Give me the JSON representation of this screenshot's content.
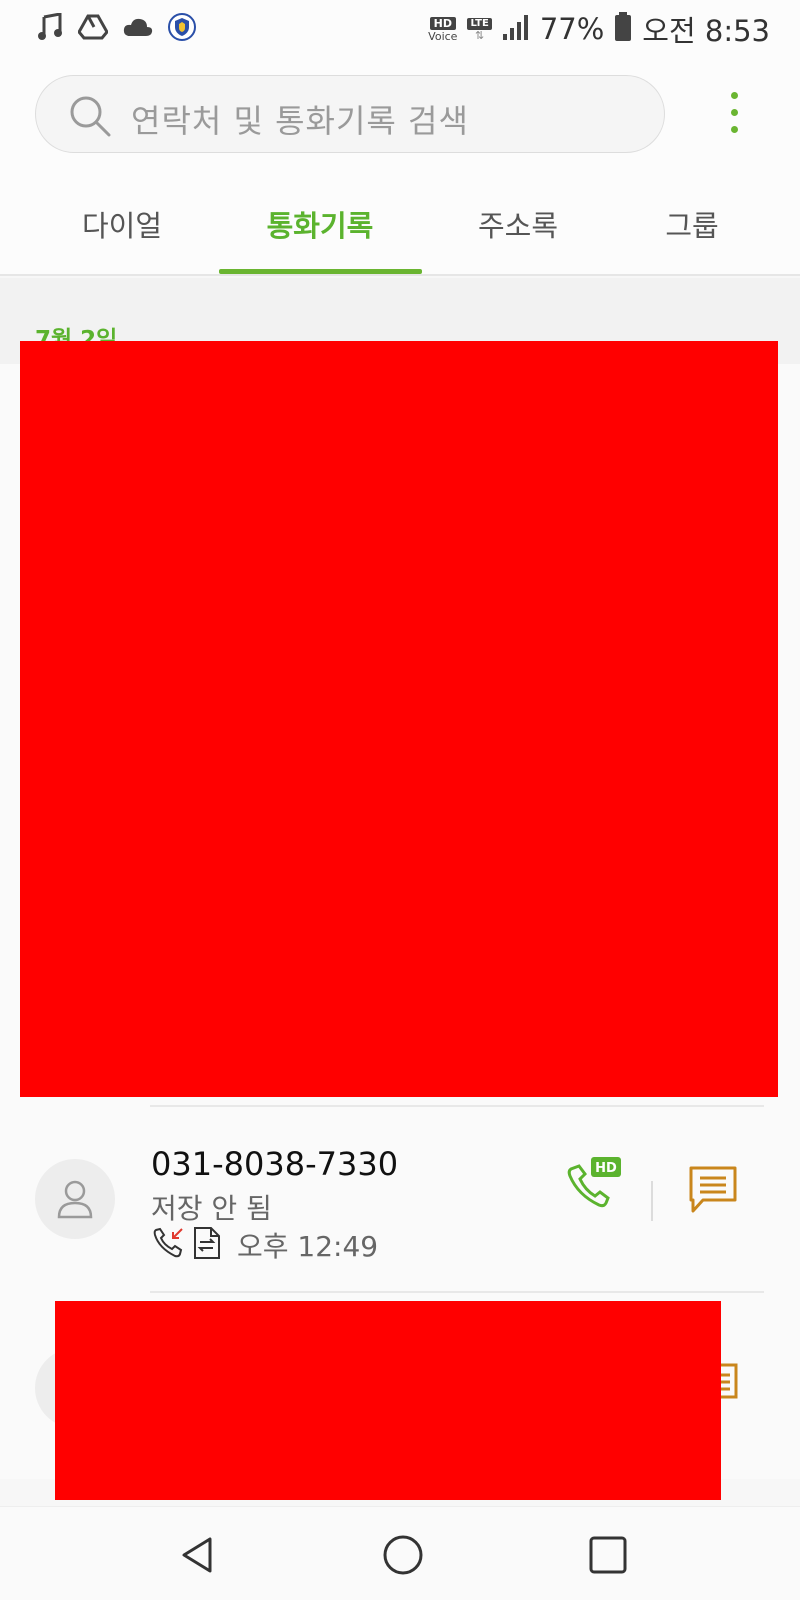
{
  "status_bar": {
    "hd_badge": "HD",
    "hd_sub": "Voice",
    "lte_badge": "LTE",
    "lte_arrows": "⇅",
    "battery_percent": "77%",
    "time": "오전 8:53",
    "icons": [
      "music-note-icon",
      "drive-icon",
      "cloud-icon",
      "shield-app-icon",
      "signal-icon",
      "battery-icon"
    ]
  },
  "search": {
    "placeholder": "연락처 및 통화기록 검색"
  },
  "tabs": [
    {
      "label": "다이얼",
      "active": false
    },
    {
      "label": "통화기록",
      "active": true
    },
    {
      "label": "주소록",
      "active": false
    },
    {
      "label": "그룹",
      "active": false
    }
  ],
  "log": {
    "date_label": "7월 2일",
    "entries": [
      {
        "number": "031-8038-7330",
        "status": "저장 안 됨",
        "time": "오후 12:49",
        "hd_badge": "HD",
        "icons": [
          "incoming-call-icon",
          "call-recording-icon",
          "hd-call-icon",
          "message-icon"
        ]
      }
    ]
  },
  "colors": {
    "accent_green": "#6ab531",
    "message_orange": "#c9861c",
    "redaction_red": "#ff0000",
    "missed_red": "#e03a2f"
  },
  "nav": {
    "icons": [
      "back-icon",
      "home-icon",
      "recents-icon"
    ]
  }
}
